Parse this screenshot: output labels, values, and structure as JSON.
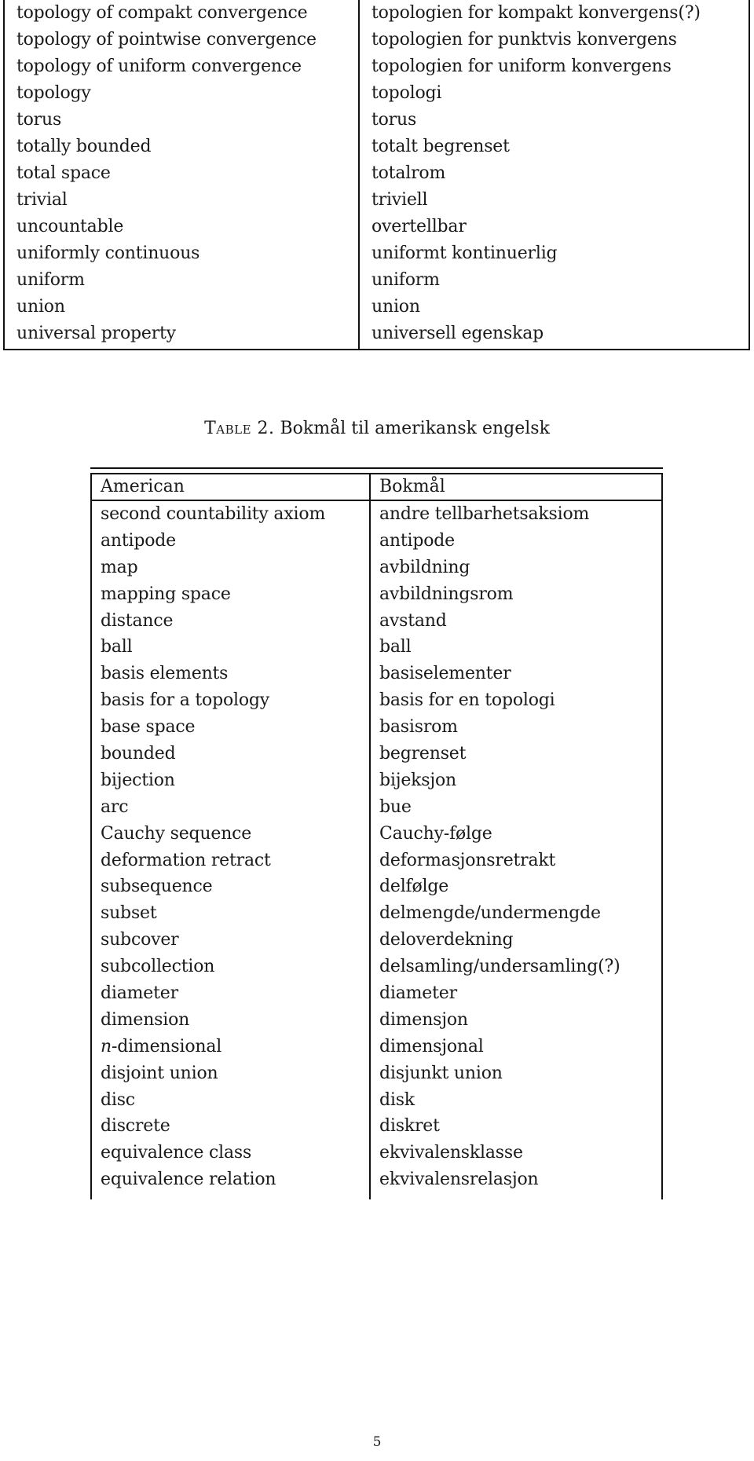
{
  "table1": {
    "rows": [
      {
        "american": "topology of compakt convergence",
        "bokmal": "topologien for kompakt konvergens(?)"
      },
      {
        "american": "topology of pointwise convergence",
        "bokmal": "topologien for punktvis konvergens"
      },
      {
        "american": "topology of uniform convergence",
        "bokmal": "topologien for uniform konvergens"
      },
      {
        "american": "topology",
        "bokmal": "topologi"
      },
      {
        "american": "torus",
        "bokmal": "torus"
      },
      {
        "american": "totally bounded",
        "bokmal": "totalt begrenset"
      },
      {
        "american": "total space",
        "bokmal": "totalrom"
      },
      {
        "american": "trivial",
        "bokmal": "triviell"
      },
      {
        "american": "uncountable",
        "bokmal": "overtellbar"
      },
      {
        "american": "uniformly continuous",
        "bokmal": "uniformt kontinuerlig"
      },
      {
        "american": "uniform",
        "bokmal": "uniform"
      },
      {
        "american": "union",
        "bokmal": "union"
      },
      {
        "american": "universal property",
        "bokmal": "universell egenskap"
      }
    ]
  },
  "caption": {
    "label": "Table 2.",
    "text": "Bokmål til amerikansk engelsk"
  },
  "table2": {
    "headers": {
      "american": "American",
      "bokmal": "Bokmål"
    },
    "rows": [
      {
        "american": "second countability axiom",
        "bokmal": "andre tellbarhetsaksiom"
      },
      {
        "american": "antipode",
        "bokmal": "antipode"
      },
      {
        "american": "map",
        "bokmal": "avbildning"
      },
      {
        "american": "mapping space",
        "bokmal": "avbildningsrom"
      },
      {
        "american": "distance",
        "bokmal": "avstand"
      },
      {
        "american": "ball",
        "bokmal": "ball"
      },
      {
        "american": "basis elements",
        "bokmal": "basiselementer"
      },
      {
        "american": "basis for a topology",
        "bokmal": "basis for en topologi"
      },
      {
        "american": "base space",
        "bokmal": "basisrom"
      },
      {
        "american": "bounded",
        "bokmal": "begrenset"
      },
      {
        "american": "bijection",
        "bokmal": "bijeksjon"
      },
      {
        "american": "arc",
        "bokmal": "bue"
      },
      {
        "american": "Cauchy sequence",
        "bokmal": "Cauchy-følge"
      },
      {
        "american": "deformation retract",
        "bokmal": "deformasjonsretrakt"
      },
      {
        "american": "subsequence",
        "bokmal": "delfølge"
      },
      {
        "american": "subset",
        "bokmal": "delmengde/undermengde"
      },
      {
        "american": "subcover",
        "bokmal": "deloverdekning"
      },
      {
        "american": "subcollection",
        "bokmal": "delsamling/undersamling(?)"
      },
      {
        "american": "diameter",
        "bokmal": "diameter"
      },
      {
        "american": "dimension",
        "bokmal": "dimensjon"
      },
      {
        "american_math": "n",
        "american": "-dimensional",
        "bokmal": "dimensjonal"
      },
      {
        "american": "disjoint union",
        "bokmal": "disjunkt union"
      },
      {
        "american": "disc",
        "bokmal": "disk"
      },
      {
        "american": "discrete",
        "bokmal": "diskret"
      },
      {
        "american": "equivalence class",
        "bokmal": "ekvivalensklasse"
      },
      {
        "american": "equivalence relation",
        "bokmal": "ekvivalensrelasjon"
      }
    ]
  },
  "page_number": "5"
}
